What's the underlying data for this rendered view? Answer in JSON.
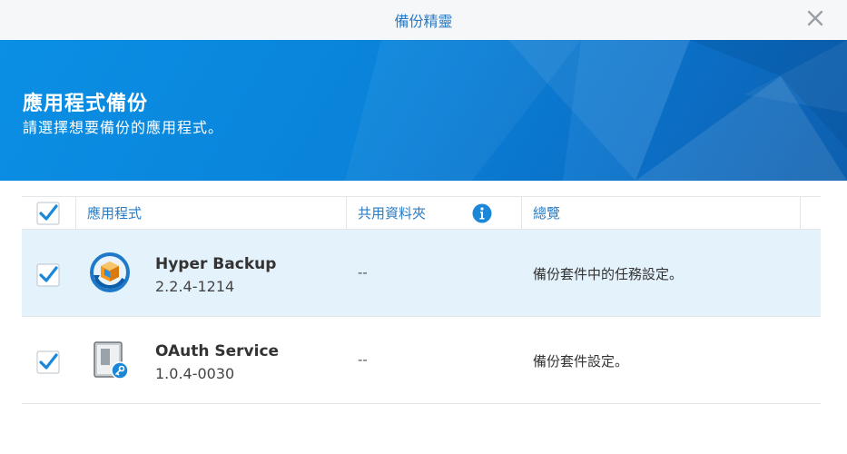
{
  "window": {
    "title": "備份精靈"
  },
  "banner": {
    "title": "應用程式備份",
    "subtitle": "請選擇想要備份的應用程式。"
  },
  "table": {
    "headers": {
      "app": "應用程式",
      "shared": "共用資料夾",
      "summary": "總覽"
    },
    "select_all_checked": true,
    "rows": [
      {
        "name": "Hyper Backup",
        "version": "2.2.4-1214",
        "shared": "--",
        "summary": "備份套件中的任務設定。",
        "checked": true,
        "selected": true,
        "icon": "hyper-backup-icon"
      },
      {
        "name": "OAuth Service",
        "version": "1.0.4-0030",
        "shared": "--",
        "summary": "備份套件設定。",
        "checked": true,
        "selected": false,
        "icon": "oauth-service-icon"
      }
    ]
  },
  "colors": {
    "accent": "#2a7bc4",
    "banner": "#0a8fe4",
    "selected_row": "#e4f2fc",
    "check": "#1b87d9"
  }
}
